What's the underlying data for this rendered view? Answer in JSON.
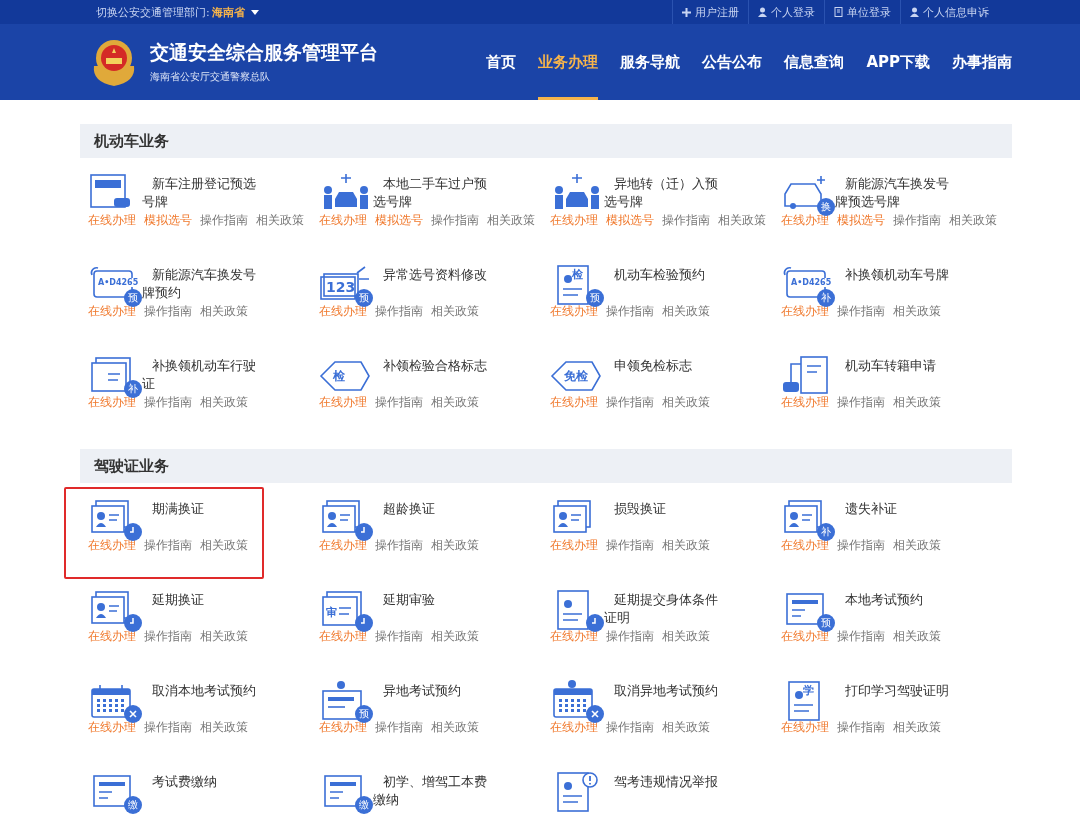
{
  "topbar": {
    "label": "切换公安交通管理部门:",
    "region": "海南省",
    "links": [
      {
        "label": "用户注册"
      },
      {
        "label": "个人登录"
      },
      {
        "label": "单位登录"
      },
      {
        "label": "个人信息申诉"
      }
    ]
  },
  "header": {
    "title": "交通安全综合服务管理平台",
    "subtitle": "海南省公安厅交通警察总队",
    "nav": [
      {
        "label": "首页",
        "selected": false
      },
      {
        "label": "业务办理",
        "selected": true
      },
      {
        "label": "服务导航",
        "selected": false
      },
      {
        "label": "公告公布",
        "selected": false
      },
      {
        "label": "信息查询",
        "selected": false
      },
      {
        "label": "APP下载",
        "selected": false
      },
      {
        "label": "办事指南",
        "selected": false
      }
    ]
  },
  "sections": [
    {
      "title": "机动车业务",
      "items": [
        {
          "title": "新车注册登记预选号牌",
          "highlighted": false,
          "links": [
            {
              "label": "在线办理",
              "kind": "action"
            },
            {
              "label": "模拟选号",
              "kind": "action"
            },
            {
              "label": "操作指南",
              "kind": "info"
            },
            {
              "label": "相关政策",
              "kind": "info"
            }
          ]
        },
        {
          "title": "本地二手车过户预选号牌",
          "highlighted": false,
          "links": [
            {
              "label": "在线办理",
              "kind": "action"
            },
            {
              "label": "模拟选号",
              "kind": "action"
            },
            {
              "label": "操作指南",
              "kind": "info"
            },
            {
              "label": "相关政策",
              "kind": "info"
            }
          ]
        },
        {
          "title": "异地转（迁）入预选号牌",
          "highlighted": false,
          "links": [
            {
              "label": "在线办理",
              "kind": "action"
            },
            {
              "label": "模拟选号",
              "kind": "action"
            },
            {
              "label": "操作指南",
              "kind": "info"
            },
            {
              "label": "相关政策",
              "kind": "info"
            }
          ]
        },
        {
          "title": "新能源汽车换发号牌预选号牌",
          "badge": {
            "kind": "text",
            "text": "换"
          },
          "highlighted": false,
          "links": [
            {
              "label": "在线办理",
              "kind": "action"
            },
            {
              "label": "模拟选号",
              "kind": "action"
            },
            {
              "label": "操作指南",
              "kind": "info"
            },
            {
              "label": "相关政策",
              "kind": "info"
            }
          ]
        },
        {
          "title": "新能源汽车换发号牌预约",
          "icon_label": "A•D4265",
          "badge": {
            "kind": "text",
            "text": "预"
          },
          "highlighted": false,
          "links": [
            {
              "label": "在线办理",
              "kind": "action"
            },
            {
              "label": "操作指南",
              "kind": "info"
            },
            {
              "label": "相关政策",
              "kind": "info"
            }
          ]
        },
        {
          "title": "异常选号资料修改",
          "icon_label": "123",
          "badge": {
            "kind": "text",
            "text": "预"
          },
          "highlighted": false,
          "links": [
            {
              "label": "在线办理",
              "kind": "action"
            },
            {
              "label": "操作指南",
              "kind": "info"
            },
            {
              "label": "相关政策",
              "kind": "info"
            }
          ]
        },
        {
          "title": "机动车检验预约",
          "icon_label": "检",
          "badge": {
            "kind": "text",
            "text": "预"
          },
          "highlighted": false,
          "links": [
            {
              "label": "在线办理",
              "kind": "action"
            },
            {
              "label": "操作指南",
              "kind": "info"
            },
            {
              "label": "相关政策",
              "kind": "info"
            }
          ]
        },
        {
          "title": "补换领机动车号牌",
          "icon_label": "A•D4265",
          "badge": {
            "kind": "text",
            "text": "补"
          },
          "highlighted": false,
          "links": [
            {
              "label": "在线办理",
              "kind": "action"
            },
            {
              "label": "操作指南",
              "kind": "info"
            },
            {
              "label": "相关政策",
              "kind": "info"
            }
          ]
        },
        {
          "title": "补换领机动车行驶证",
          "badge": {
            "kind": "text",
            "text": "补"
          },
          "highlighted": false,
          "links": [
            {
              "label": "在线办理",
              "kind": "action"
            },
            {
              "label": "操作指南",
              "kind": "info"
            },
            {
              "label": "相关政策",
              "kind": "info"
            }
          ]
        },
        {
          "title": "补领检验合格标志",
          "icon_label": "检",
          "highlighted": false,
          "links": [
            {
              "label": "在线办理",
              "kind": "action"
            },
            {
              "label": "操作指南",
              "kind": "info"
            },
            {
              "label": "相关政策",
              "kind": "info"
            }
          ]
        },
        {
          "title": "申领免检标志",
          "icon_label": "免检",
          "highlighted": false,
          "links": [
            {
              "label": "在线办理",
              "kind": "action"
            },
            {
              "label": "操作指南",
              "kind": "info"
            },
            {
              "label": "相关政策",
              "kind": "info"
            }
          ]
        },
        {
          "title": "机动车转籍申请",
          "highlighted": false,
          "links": [
            {
              "label": "在线办理",
              "kind": "action"
            },
            {
              "label": "操作指南",
              "kind": "info"
            },
            {
              "label": "相关政策",
              "kind": "info"
            }
          ]
        }
      ]
    },
    {
      "title": "驾驶证业务",
      "items": [
        {
          "title": "期满换证",
          "badge": {
            "kind": "clock"
          },
          "highlighted": true,
          "links": [
            {
              "label": "在线办理",
              "kind": "action"
            },
            {
              "label": "操作指南",
              "kind": "info"
            },
            {
              "label": "相关政策",
              "kind": "info"
            }
          ]
        },
        {
          "title": "超龄换证",
          "badge": {
            "kind": "clock"
          },
          "highlighted": false,
          "links": [
            {
              "label": "在线办理",
              "kind": "action"
            },
            {
              "label": "操作指南",
              "kind": "info"
            },
            {
              "label": "相关政策",
              "kind": "info"
            }
          ]
        },
        {
          "title": "损毁换证",
          "highlighted": false,
          "links": [
            {
              "label": "在线办理",
              "kind": "action"
            },
            {
              "label": "操作指南",
              "kind": "info"
            },
            {
              "label": "相关政策",
              "kind": "info"
            }
          ]
        },
        {
          "title": "遗失补证",
          "badge": {
            "kind": "text",
            "text": "补"
          },
          "highlighted": false,
          "links": [
            {
              "label": "在线办理",
              "kind": "action"
            },
            {
              "label": "操作指南",
              "kind": "info"
            },
            {
              "label": "相关政策",
              "kind": "info"
            }
          ]
        },
        {
          "title": "延期换证",
          "badge": {
            "kind": "clock"
          },
          "highlighted": false,
          "links": [
            {
              "label": "在线办理",
              "kind": "action"
            },
            {
              "label": "操作指南",
              "kind": "info"
            },
            {
              "label": "相关政策",
              "kind": "info"
            }
          ]
        },
        {
          "title": "延期审验",
          "icon_label": "审",
          "badge": {
            "kind": "clock"
          },
          "highlighted": false,
          "links": [
            {
              "label": "在线办理",
              "kind": "action"
            },
            {
              "label": "操作指南",
              "kind": "info"
            },
            {
              "label": "相关政策",
              "kind": "info"
            }
          ]
        },
        {
          "title": "延期提交身体条件证明",
          "badge": {
            "kind": "clock"
          },
          "highlighted": false,
          "links": [
            {
              "label": "在线办理",
              "kind": "action"
            },
            {
              "label": "操作指南",
              "kind": "info"
            },
            {
              "label": "相关政策",
              "kind": "info"
            }
          ]
        },
        {
          "title": "本地考试预约",
          "badge": {
            "kind": "text",
            "text": "预"
          },
          "highlighted": false,
          "links": [
            {
              "label": "在线办理",
              "kind": "action"
            },
            {
              "label": "操作指南",
              "kind": "info"
            },
            {
              "label": "相关政策",
              "kind": "info"
            }
          ]
        },
        {
          "title": "取消本地考试预约",
          "badge": {
            "kind": "cancel"
          },
          "highlighted": false,
          "links": [
            {
              "label": "在线办理",
              "kind": "action"
            },
            {
              "label": "操作指南",
              "kind": "info"
            },
            {
              "label": "相关政策",
              "kind": "info"
            }
          ]
        },
        {
          "title": "异地考试预约",
          "badge": {
            "kind": "text",
            "text": "预"
          },
          "highlighted": false,
          "links": [
            {
              "label": "在线办理",
              "kind": "action"
            },
            {
              "label": "操作指南",
              "kind": "info"
            },
            {
              "label": "相关政策",
              "kind": "info"
            }
          ]
        },
        {
          "title": "取消异地考试预约",
          "badge": {
            "kind": "cancel"
          },
          "highlighted": false,
          "links": [
            {
              "label": "在线办理",
              "kind": "action"
            },
            {
              "label": "操作指南",
              "kind": "info"
            },
            {
              "label": "相关政策",
              "kind": "info"
            }
          ]
        },
        {
          "title": "打印学习驾驶证明",
          "icon_label": "学",
          "highlighted": false,
          "links": [
            {
              "label": "在线办理",
              "kind": "action"
            },
            {
              "label": "操作指南",
              "kind": "info"
            },
            {
              "label": "相关政策",
              "kind": "info"
            }
          ]
        },
        {
          "title": "考试费缴纳",
          "badge": {
            "kind": "text",
            "text": "缴"
          },
          "highlighted": false
        },
        {
          "title": "初学、增驾工本费缴纳",
          "badge": {
            "kind": "text",
            "text": "缴"
          },
          "highlighted": false
        },
        {
          "title": "驾考违规情况举报",
          "badge": {
            "kind": "alert"
          },
          "highlighted": false
        }
      ]
    }
  ]
}
